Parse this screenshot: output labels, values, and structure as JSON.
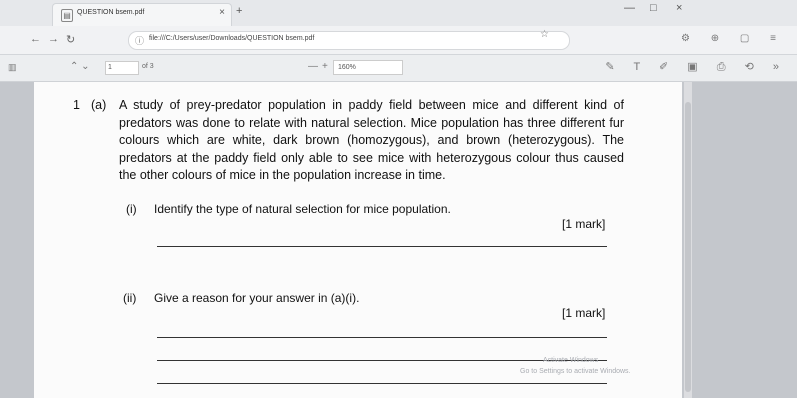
{
  "browser": {
    "tab_title": "QUESTION bsem.pdf",
    "tab_close": "×",
    "new_tab": "+",
    "url": "file:///C:/Users/user/Downloads/QUESTION bsem.pdf",
    "minimize": "—",
    "restore": "□",
    "close": "×"
  },
  "pdf_toolbar": {
    "page_number": "1",
    "page_of": "of 3",
    "zoom_minus": "—",
    "zoom_plus": "+",
    "zoom_value": "160%"
  },
  "question": {
    "number": "1",
    "part": "(a)",
    "text": "A study of prey-predator population in paddy field between mice and different kind of predators was done to relate with natural selection. Mice population has three different fur colours which are white, dark brown (homozygous), and brown (heterozygous). The predators at the paddy field only able to see mice with heterozygous colour thus caused the other colours of mice in the population increase in time.",
    "sub_i": {
      "number": "(i)",
      "text": "Identify the type of natural selection for mice population.",
      "mark": "[1 mark]"
    },
    "sub_ii": {
      "number": "(ii)",
      "text": "Give a reason for your answer in (a)(i).",
      "mark": "[1 mark]"
    }
  },
  "watermark": {
    "line1": "Activate Windows",
    "line2": "Go to Settings to activate Windows."
  }
}
